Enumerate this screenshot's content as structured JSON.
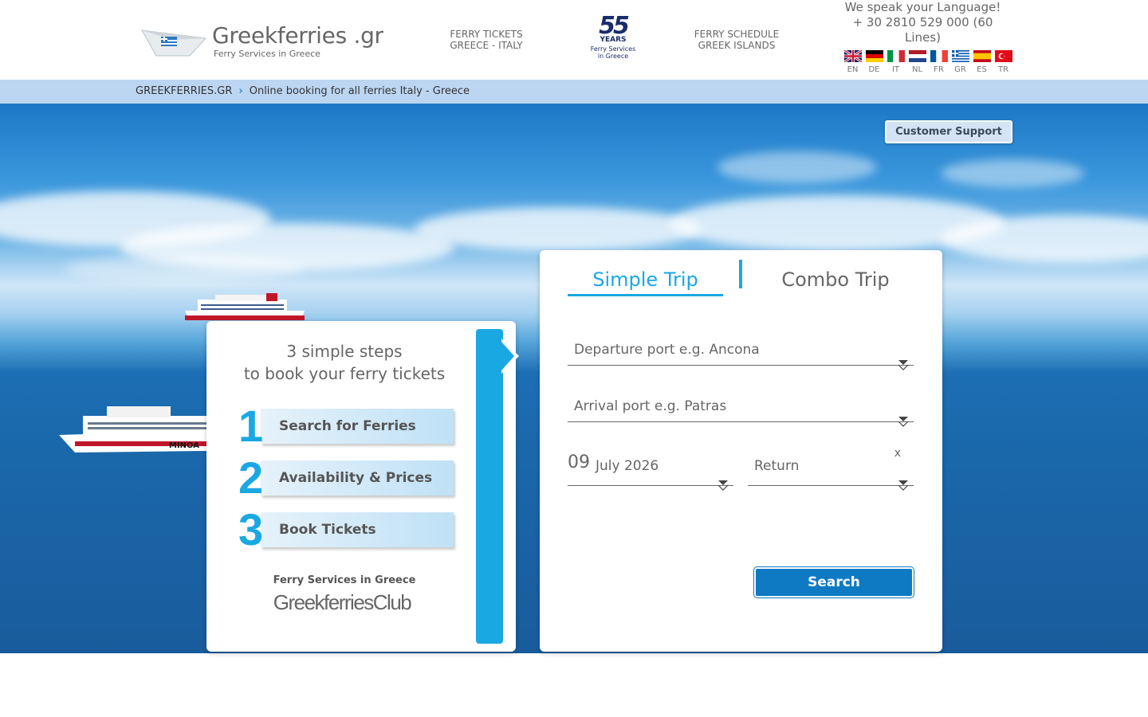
{
  "header": {
    "logo_title": "Greekferries .gr",
    "logo_subtitle": "Ferry Services in Greece",
    "nav": [
      {
        "line1": "FERRY TICKETS",
        "line2": "GREECE - ITALY"
      },
      {
        "line1": "FERRY SCHEDULE",
        "line2": "GREEK ISLANDS"
      }
    ],
    "anniversary": {
      "number": "55",
      "years": "YEARS",
      "line1": "Ferry Services",
      "line2": "in Greece"
    },
    "language_text": "We speak your Language!",
    "phone_text": "+ 30 2810 529 000 (60 Lines)",
    "languages": [
      {
        "code": "EN",
        "icon": "uk-flag-icon"
      },
      {
        "code": "DE",
        "icon": "germany-flag-icon"
      },
      {
        "code": "IT",
        "icon": "italy-flag-icon"
      },
      {
        "code": "NL",
        "icon": "netherlands-flag-icon"
      },
      {
        "code": "FR",
        "icon": "france-flag-icon"
      },
      {
        "code": "GR",
        "icon": "greece-flag-icon"
      },
      {
        "code": "ES",
        "icon": "spain-flag-icon"
      },
      {
        "code": "TR",
        "icon": "turkey-flag-icon"
      }
    ]
  },
  "breadcrumb": {
    "home": "GREEKFERRIES.GR",
    "current": "Online booking for all ferries Italy - Greece"
  },
  "support_button": "Customer Support",
  "steps": {
    "title_line1": "3 simple steps",
    "title_line2": "to book your ferry tickets",
    "items": [
      {
        "num": "1",
        "label": "Search for Ferries"
      },
      {
        "num": "2",
        "label": "Availability & Prices"
      },
      {
        "num": "3",
        "label": "Book Tickets"
      }
    ],
    "club_subtitle": "Ferry Services in Greece",
    "club_name": "GreekferriesClub"
  },
  "booking": {
    "tabs": [
      {
        "label": "Simple Trip",
        "active": true
      },
      {
        "label": "Combo Trip",
        "active": false
      }
    ],
    "departure_placeholder": "Departure port e.g. Ancona",
    "arrival_placeholder": "Arrival port e.g. Patras",
    "date_day": "09",
    "date_month_year": "July 2026",
    "return_label": "Return",
    "return_clear": "x",
    "search_button": "Search"
  },
  "colors": {
    "accent": "#1aa8e3",
    "button": "#0f7ac4",
    "breadcrumb_bg": "#bcd6f2"
  }
}
